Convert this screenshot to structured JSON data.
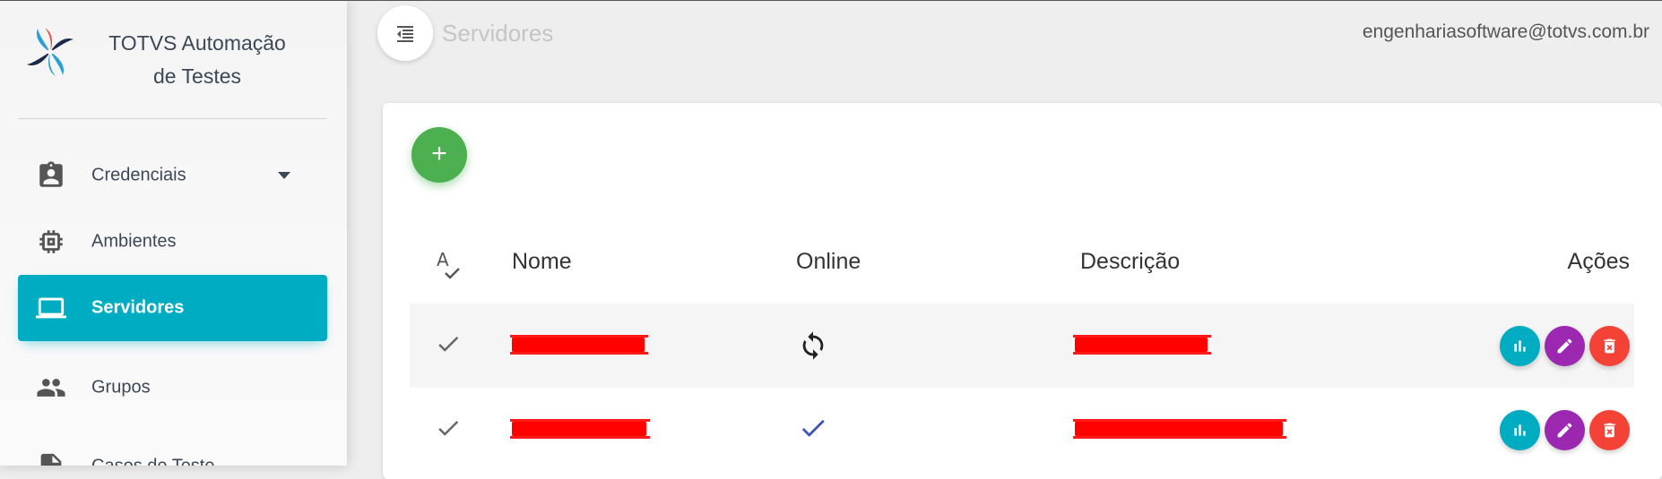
{
  "app": {
    "title": "TOTVS Automação\nde Testes"
  },
  "sidebar": {
    "items": [
      {
        "label": "Credenciais",
        "icon": "badge-icon",
        "has_dropdown": true,
        "active": false
      },
      {
        "label": "Ambientes",
        "icon": "chip-icon",
        "active": false
      },
      {
        "label": "Servidores",
        "icon": "laptop-icon",
        "active": true
      },
      {
        "label": "Grupos",
        "icon": "people-icon",
        "active": false
      },
      {
        "label": "Casos de Teste",
        "icon": "file-icon",
        "active": false
      }
    ]
  },
  "header": {
    "page_title": "Servidores",
    "user_email": "engenhariasoftware@totvs.com.br"
  },
  "table": {
    "columns": [
      "Nome",
      "Online",
      "Descrição",
      "Ações"
    ],
    "rows": [
      {
        "selected": true,
        "online": "syncing",
        "name_redacted": true,
        "description_redacted": true
      },
      {
        "selected": true,
        "online": "online",
        "name_redacted": true,
        "description_redacted": true
      }
    ]
  },
  "colors": {
    "accent": "#00acc1",
    "add": "#4caf50",
    "edit": "#9c27b0",
    "delete": "#f44336",
    "redaction": "#ff0000"
  }
}
